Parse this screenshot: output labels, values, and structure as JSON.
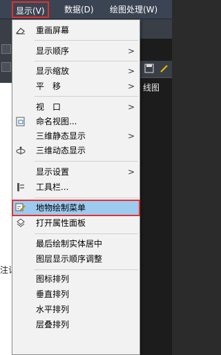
{
  "menubar": {
    "view": "显示(V)",
    "data": "数据(D)",
    "draw": "绘图处理(W)"
  },
  "background": {
    "canvas_label": "线图",
    "side_text": "注记"
  },
  "menu": {
    "items": [
      {
        "label": "重画屏幕",
        "icon": "eraser-icon"
      },
      {
        "label": "显示顺序",
        "submenu": ">"
      },
      {
        "label": "显示缩放",
        "submenu": ">"
      },
      {
        "label": "平　移",
        "submenu": ">"
      },
      {
        "label": "视　口",
        "submenu": ">"
      },
      {
        "label": "命名视图...",
        "icon": "named-view-icon"
      },
      {
        "label": "三维静态显示",
        "submenu": ">"
      },
      {
        "label": "三维动态显示",
        "icon": "orbit-icon"
      },
      {
        "label": "显示设置",
        "submenu": ">"
      },
      {
        "label": "工具栏...",
        "icon": "toolbar-icon"
      },
      {
        "label": "地物绘制菜单",
        "icon": "feature-draw-icon",
        "highlighted": true
      },
      {
        "label": "打开属性面板",
        "icon": "properties-icon"
      },
      {
        "label": "最后绘制实体居中"
      },
      {
        "label": "图层显示顺序调整"
      },
      {
        "label": "图标排列"
      },
      {
        "label": "垂直排列"
      },
      {
        "label": "水平排列"
      },
      {
        "label": "层叠排列"
      }
    ]
  },
  "colors": {
    "highlight": "#9ccbef",
    "annotation_red": "#e53030",
    "menubar_bg": "#3b4453"
  }
}
